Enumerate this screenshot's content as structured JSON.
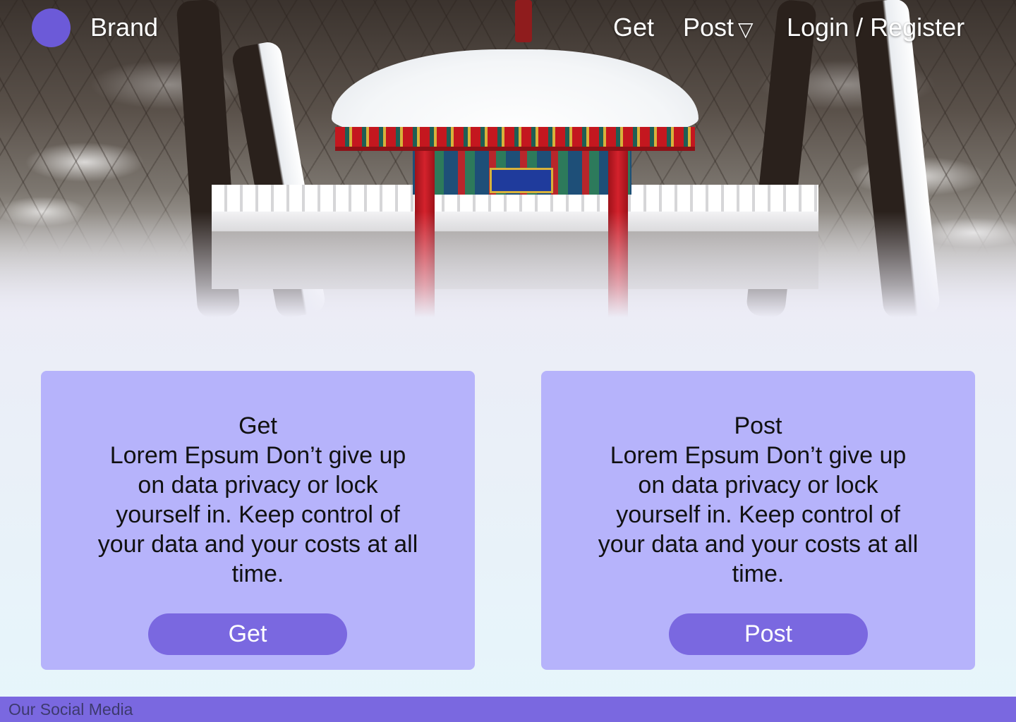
{
  "nav": {
    "brand": "Brand",
    "links": [
      {
        "label": "Get"
      },
      {
        "label": "Post",
        "caret": "▽"
      },
      {
        "label": "Login / Register"
      }
    ]
  },
  "cards": [
    {
      "title": "Get",
      "body": "Lorem Epsum Don’t give up on data privacy or lock yourself in. Keep control of your data and your costs at all time.",
      "button": "Get"
    },
    {
      "title": "Post",
      "body": "Lorem Epsum Don’t give up on data privacy or lock yourself in. Keep control of your data and your costs at all time.",
      "button": "Post"
    }
  ],
  "footer": {
    "text": "Our Social Media"
  },
  "colors": {
    "brand_accent": "#6c5ad8",
    "card_bg": "#b6b3fb",
    "button_bg": "#7a68e0",
    "footer_bg": "#7a68e0"
  }
}
